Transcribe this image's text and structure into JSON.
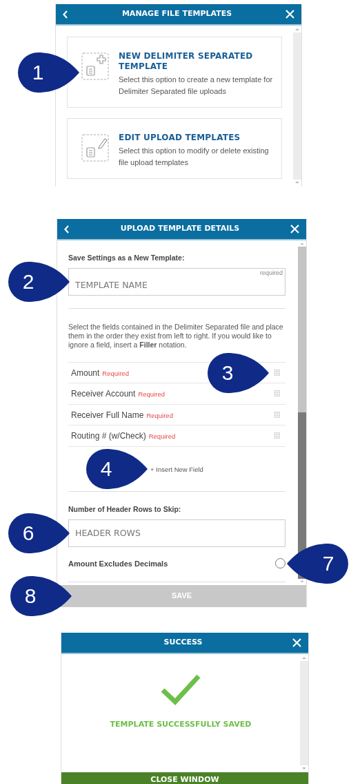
{
  "manage": {
    "title": "MANAGE FILE TEMPLATES",
    "options": [
      {
        "kind": "create",
        "title": "NEW DELIMITER SEPARATED TEMPLATE",
        "description": "Select this option to create a new template for Delimiter Separated file uploads",
        "callout": {
          "number": "1",
          "kind": "right"
        }
      },
      {
        "kind": "edit",
        "title": "EDIT UPLOAD TEMPLATES",
        "description": "Select this option to modify or delete existing file upload templates"
      }
    ]
  },
  "details": {
    "title": "UPLOAD TEMPLATE DETAILS",
    "name_label": "Save Settings as a New Template:",
    "name_field": {
      "placeholder": "TEMPLATE NAME",
      "hint": "required",
      "callout": {
        "number": "2",
        "kind": "right"
      }
    },
    "instructions": "Select the fields contained in the Delimiter Separated file and place them in the order they exist from left to right. If you would like to ignore a field, insert a **Filler** notation.",
    "fields": [
      {
        "name": "Amount",
        "required_label": "Required",
        "callout": {
          "number": "3",
          "kind": "right"
        }
      },
      {
        "name": "Receiver Account",
        "required_label": "Required"
      },
      {
        "name": "Receiver Full Name",
        "required_label": "Required"
      },
      {
        "name": "Routing # (w/Check)",
        "required_label": "Required"
      }
    ],
    "insert_link": {
      "text": "+ Insert New Field",
      "callout": {
        "number": "4",
        "kind": "right"
      }
    },
    "header_label": "Number of Header Rows to Skip:",
    "header_field": {
      "placeholder": "HEADER ROWS",
      "callout": {
        "number": "6",
        "kind": "right"
      }
    },
    "decimals": {
      "label": "Amount Excludes Decimals",
      "checked": false,
      "callout": {
        "number": "7",
        "kind": "left"
      }
    },
    "save_button": {
      "label": "SAVE",
      "disabled": true,
      "callout": {
        "number": "8",
        "kind": "right"
      }
    }
  },
  "success": {
    "title": "SUCCESS",
    "message": "TEMPLATE SUCCESSFULLY SAVED",
    "button": "CLOSE WINDOW"
  }
}
